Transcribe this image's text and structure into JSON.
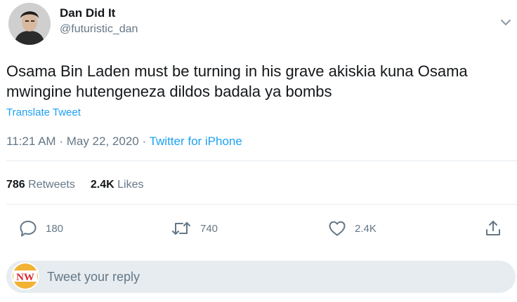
{
  "author": {
    "display_name": "Dan Did It",
    "handle": "@futuristic_dan"
  },
  "tweet": {
    "text_line1": "Osama Bin Laden must be turning in his grave akiskia kuna Osama",
    "text_line2": "mwingine hutengeneza dildos badala ya bombs",
    "translate_label": "Translate Tweet",
    "time": "11:21 AM",
    "separator": "·",
    "date": "May 22, 2020",
    "source": "Twitter for iPhone"
  },
  "stats": {
    "retweets_count": "786",
    "retweets_label": "Retweets",
    "likes_count": "2.4K",
    "likes_label": "Likes"
  },
  "actions": {
    "reply_count": "180",
    "retweet_count": "740",
    "like_count": "2.4K"
  },
  "reply": {
    "placeholder": "Tweet your reply",
    "avatar_text": "NW"
  },
  "colors": {
    "accent": "#1da1f2",
    "secondary_text": "#657786",
    "reply_box": "#e6ecf0",
    "reply_avatar_red": "#d8262c",
    "reply_avatar_gold": "#f2b233"
  },
  "icons": {
    "caret": "chevron-down-icon",
    "reply": "reply-icon",
    "retweet": "retweet-icon",
    "like": "heart-icon",
    "share": "share-icon"
  }
}
